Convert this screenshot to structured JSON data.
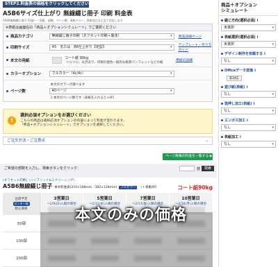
{
  "step_banner": "STEP2.料金表の価格をクリックしてください",
  "title": "A5B6サイズ仕上がり 無線綴じ冊子 印刷 料金表",
  "subtitle": "A5B6無線綴じ冊子 50部〜・用紙、部数、ページ数、表紙カラー、表紙加工など全て対応します",
  "form": {
    "header": "※表紙は画面右の「商品＋オプションシミュレート」でご選択ください",
    "rows": [
      {
        "label": "商品カテゴリ",
        "value": "無線綴じ冊子印刷（オフセット印刷＋製本）",
        "link": "商品詳細ページ"
      },
      {
        "label": "印刷サイズ",
        "value": "A5　または　B6仕上がり【定型】",
        "link": "テンプレート・作り方ガイド"
      },
      {
        "label": "本文の用紙",
        "value": "コート紙 90kg",
        "sub": "ツルツル、光沢あり、印刷の発色一般的な紙厚パンフレットなどの紙",
        "link": "用紙の詳細"
      },
      {
        "label": "カラーオプション",
        "value": "フルカラー（4c/4c）",
        "link": ""
      },
      {
        "label": "ページ数",
        "value": "本文のカラーが選べます",
        "value2": "40ページ",
        "value3": "1 本文のページ数です（表紙を入れると+4P）",
        "link": ""
      }
    ]
  },
  "warning": {
    "title": "選択必須オプションをお選びください",
    "line1": "こちらの商品は選択必須オプションの内容によって料金が変わります。",
    "line2": "「商品+オプションシミュレート」でオプションを選択してください。",
    "icon": "!"
  },
  "notes": {
    "label": "ご注文方法・ご注意点",
    "chevron": "⌄"
  },
  "green_button": "ページ数毎の料金を一覧する ▶",
  "search": {
    "hint": "ご希望の部数を入力し、検索ボタンをクリック：",
    "unit": "部",
    "button": "検索"
  },
  "price_header": {
    "tag": "[オフセット印刷]（ハイブリッド&スクリーニング）",
    "title": "A5B6無線綴じ冊子",
    "detail": "本文料金表(210×148mm／182×128mm)",
    "color_badge": "フルカラー",
    "suffix": "（＋表紙4P）",
    "paper": "コート紙90kg"
  },
  "table": {
    "first_header_line1": "出荷予定",
    "first_header_badge": "センター発",
    "first_header_line2": "税込価格",
    "columns": [
      {
        "days": "3営業日",
        "date": "～2/9(日)入稿の場合"
      },
      {
        "days": "5営業日",
        "date": "～2/11(水)入稿の場合"
      },
      {
        "days": "7営業日",
        "date": "～2/13(金)入稿の場合"
      },
      {
        "days": "10営業日",
        "date": "～2/16(月)入稿の場合"
      }
    ],
    "rows": [
      "50部",
      "100部",
      "200部"
    ]
  },
  "overlay": "本文のみの価格",
  "sidebar": {
    "title": "商品＋オプション\nシミュレート",
    "groups": [
      {
        "label": "綴じ方向(選択必須)",
        "value": "未選択",
        "info": "i"
      },
      {
        "label": "表紙選択(選択必須)",
        "value": "未選択",
        "info": "i"
      },
      {
        "label": "デザイン制作を依頼する",
        "value": "なし",
        "info": "i"
      },
      {
        "label": "Officeデータ変換",
        "value": "",
        "tag": "非対応",
        "info": "i"
      },
      {
        "label": "遊び紙(表紙)",
        "value": "なし",
        "info": "i"
      },
      {
        "label": "箔押し加工(表紙)",
        "value": "なし",
        "info": "i"
      },
      {
        "label": "エンボス加工",
        "value": "なし",
        "info": "i"
      },
      {
        "label": "表紙加工",
        "value": "なし",
        "info": "i"
      }
    ]
  },
  "colors": {
    "accent": "#1a4ea0",
    "banner": "#2d4a7a",
    "green": "#1e9a4e",
    "red": "#d42222",
    "warning_bg": "#fff6cc"
  }
}
